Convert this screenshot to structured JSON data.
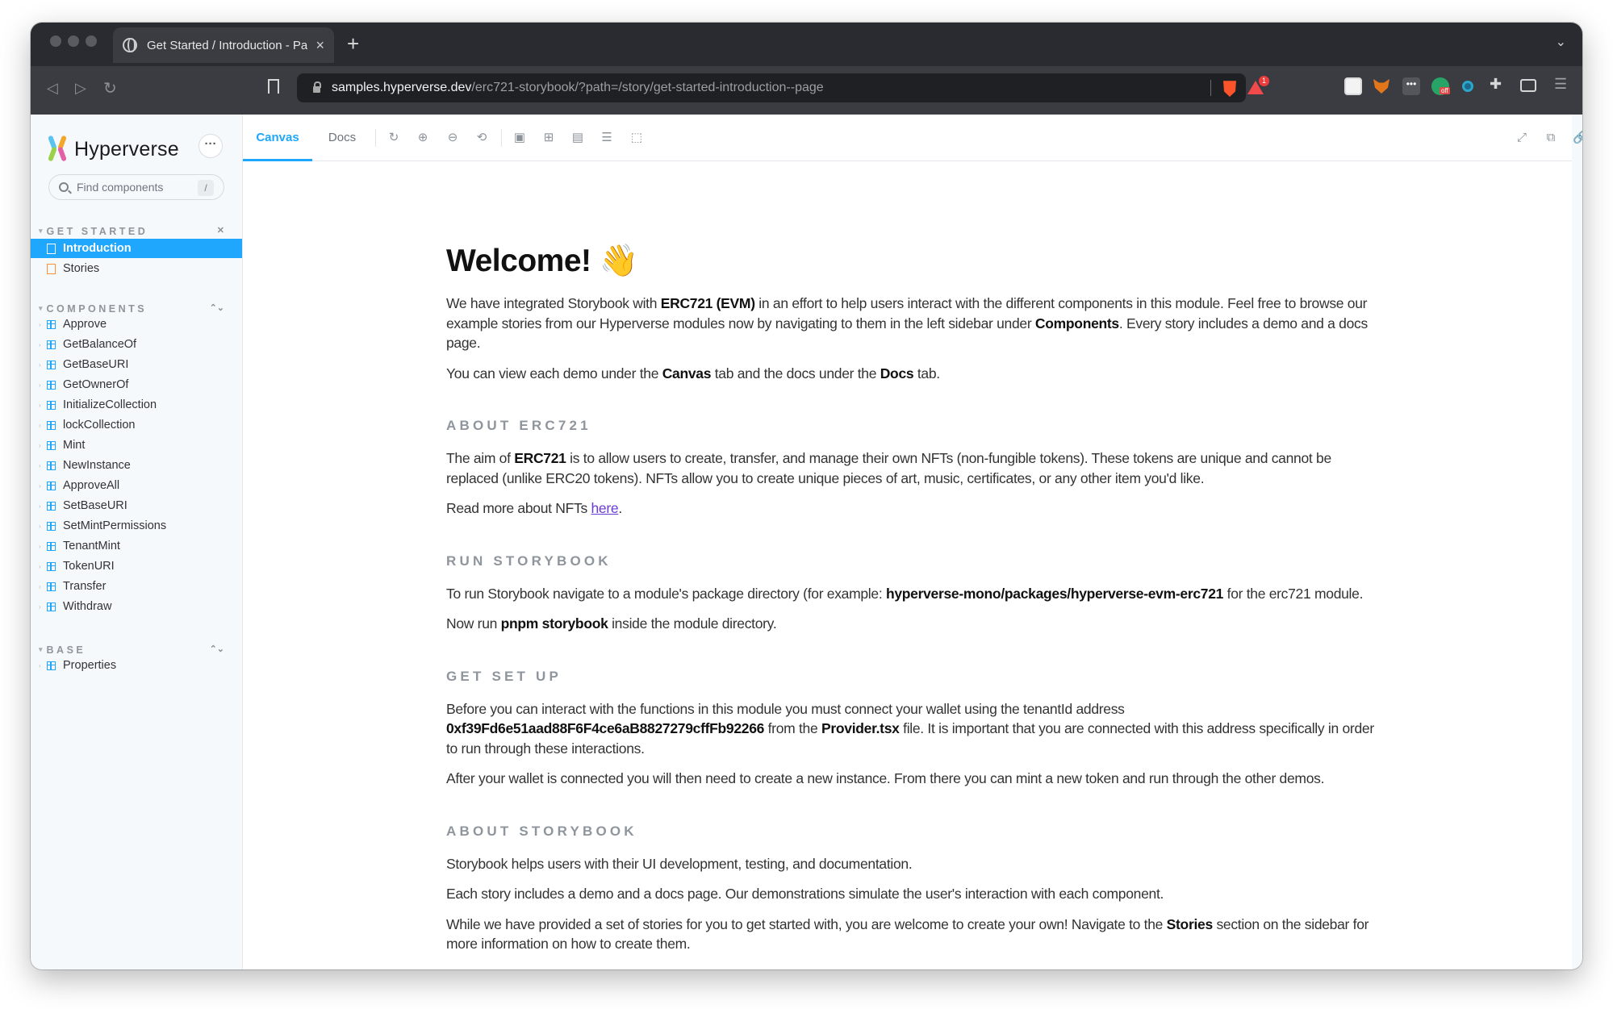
{
  "browser": {
    "tab_title": "Get Started / Introduction - Page",
    "url_domain": "samples.hyperverse.dev",
    "url_path": "/erc721-storybook/?path=/story/get-started-introduction--page",
    "rewards_badge": "1",
    "extension_off_badge": "off"
  },
  "sidebar": {
    "brand": "Hyperverse",
    "search_placeholder": "Find components",
    "search_shortcut": "/",
    "sections": [
      {
        "title": "GET STARTED",
        "items": [
          "Introduction",
          "Stories"
        ]
      },
      {
        "title": "COMPONENTS",
        "items": [
          "Approve",
          "GetBalanceOf",
          "GetBaseURI",
          "GetOwnerOf",
          "InitializeCollection",
          "lockCollection",
          "Mint",
          "NewInstance",
          "ApproveAll",
          "SetBaseURI",
          "SetMintPermissions",
          "TenantMint",
          "TokenURI",
          "Transfer",
          "Withdraw"
        ]
      },
      {
        "title": "BASE",
        "items": [
          "Properties"
        ]
      }
    ],
    "active_item": "Introduction"
  },
  "toolbar": {
    "tabs": [
      "Canvas",
      "Docs"
    ],
    "active_tab": "Canvas"
  },
  "doc": {
    "title": "Welcome!",
    "title_emoji": "👋",
    "intro_1": {
      "a": "We have integrated Storybook with ",
      "b": "ERC721 (EVM)",
      "c": " in an effort to help users interact with the different components in this module. Feel free to browse our example stories from our Hyperverse modules now by navigating to them in the left sidebar under ",
      "d": "Components",
      "e": ". Every story includes a demo and a docs page."
    },
    "intro_2": {
      "a": "You can view each demo under the ",
      "b": "Canvas",
      "c": " tab and the docs under the ",
      "d": "Docs",
      "e": " tab."
    },
    "about_heading": "ABOUT ERC721",
    "about_1": {
      "a": "The aim of ",
      "b": "ERC721",
      "c": " is to allow users to create, transfer, and manage their own NFTs (non-fungible tokens). These tokens are unique and cannot be replaced (unlike ERC20 tokens). NFTs allow you to create unique pieces of art, music, certificates, or any other item you'd like."
    },
    "about_2": {
      "a": "Read more about NFTs ",
      "link": "here",
      "c": "."
    },
    "run_heading": "RUN STORYBOOK",
    "run_1": {
      "a": "To run Storybook navigate to a module's package directory (for example: ",
      "b": "hyperverse-mono/packages/hyperverse-evm-erc721",
      "c": " for the erc721 module."
    },
    "run_2": {
      "a": "Now run ",
      "b": "pnpm storybook",
      "c": " inside the module directory."
    },
    "setup_heading": "GET SET UP",
    "setup_1": {
      "a": "Before you can interact with the functions in this module you must connect your wallet using the tenantId address ",
      "b": "0xf39Fd6e51aad88F6F4ce6aB8827279cffFb92266",
      "c": " from the ",
      "d": "Provider.tsx",
      "e": " file. It is important that you are connected with this address specifically in order to run through these interactions."
    },
    "setup_2": "After your wallet is connected you will then need to create a new instance. From there you can mint a new token and run through the other demos.",
    "storybook_heading": "ABOUT STORYBOOK",
    "storybook_1": "Storybook helps users with their UI development, testing, and documentation.",
    "storybook_2": "Each story includes a demo and a docs page. Our demonstrations simulate the user's interaction with each component.",
    "storybook_3": {
      "a": "While we have provided a set of stories for you to get started with, you are welcome to create your own! Navigate to the ",
      "b": "Stories",
      "c": " section on the sidebar for more information on how to create them."
    }
  }
}
